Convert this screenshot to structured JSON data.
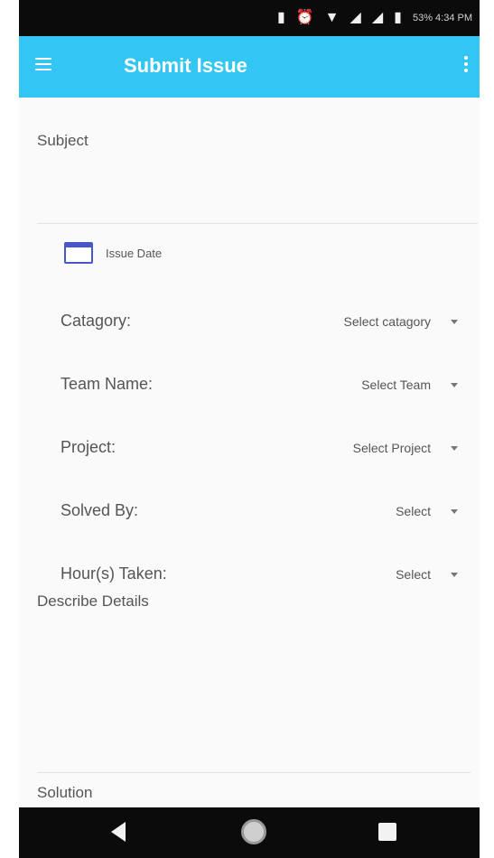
{
  "status_bar": {
    "time_text": "53% 4:34 PM",
    "icons": [
      "vibrate-icon",
      "alarm-icon",
      "wifi-icon",
      "signal-icon",
      "signal-icon",
      "battery-icon"
    ]
  },
  "app_bar": {
    "title": "Submit Issue",
    "color": "#33c6f2"
  },
  "form": {
    "subject_label": "Subject",
    "issue_date_label": "Issue Date",
    "fields": [
      {
        "label": "Catagory:",
        "value": "Select catagory"
      },
      {
        "label": "Team Name:",
        "value": "Select Team"
      },
      {
        "label": "Project:",
        "value": "Select Project"
      },
      {
        "label": "Solved By:",
        "value": "Select"
      },
      {
        "label": "Hour(s) Taken:",
        "value": "Select"
      }
    ],
    "describe_label": "Describe Details",
    "solution_label": "Solution"
  }
}
